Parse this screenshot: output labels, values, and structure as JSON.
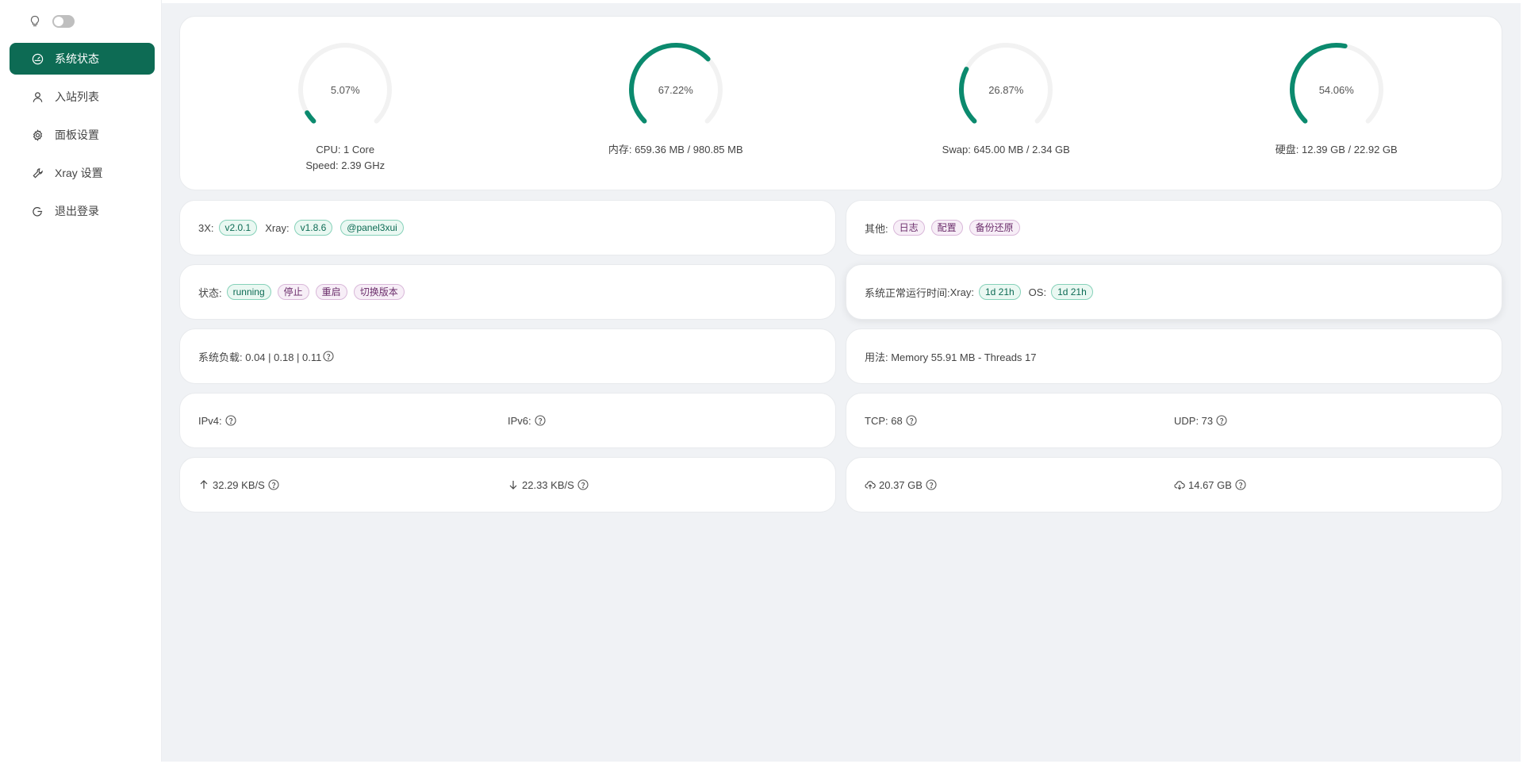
{
  "theme": {
    "toggle_on": false
  },
  "sidebar": {
    "items": [
      {
        "label": "系统状态",
        "icon": "dashboard-icon",
        "active": true
      },
      {
        "label": "入站列表",
        "icon": "user-icon"
      },
      {
        "label": "面板设置",
        "icon": "gear-icon"
      },
      {
        "label": "Xray 设置",
        "icon": "tool-icon"
      },
      {
        "label": "退出登录",
        "icon": "logout-icon"
      }
    ]
  },
  "gauges": [
    {
      "percent_text": "5.07%",
      "percent": 5.07,
      "line1": "CPU: 1 Core",
      "line2": "Speed: 2.39 GHz"
    },
    {
      "percent_text": "67.22%",
      "percent": 67.22,
      "line1": "内存: 659.36 MB / 980.85 MB",
      "line2": ""
    },
    {
      "percent_text": "26.87%",
      "percent": 26.87,
      "line1": "Swap: 645.00 MB / 2.34 GB",
      "line2": ""
    },
    {
      "percent_text": "54.06%",
      "percent": 54.06,
      "line1": "硬盘: 12.39 GB / 22.92 GB",
      "line2": ""
    }
  ],
  "colors": {
    "accent": "#0d6b54",
    "gauge_fg": "#0b8a6e",
    "gauge_bg": "#f2f2f2"
  },
  "version": {
    "label_3x": "3X:",
    "v3x": "v2.0.1",
    "label_xray": "Xray:",
    "vxray": "v1.8.6",
    "tg": "@panel3xui"
  },
  "other": {
    "label": "其他:",
    "log": "日志",
    "config": "配置",
    "backup": "备份还原"
  },
  "status": {
    "label": "状态:",
    "running": "running",
    "stop": "停止",
    "restart": "重启",
    "switch": "切换版本"
  },
  "uptime": {
    "label": "系统正常运行时间:",
    "xray_label": "Xray:",
    "xray": "1d 21h",
    "os_label": "OS:",
    "os": "1d 21h"
  },
  "load": {
    "text": "系统负载: 0.04 | 0.18 | 0.11"
  },
  "usage": {
    "text": "用法: Memory 55.91 MB - Threads 17"
  },
  "ip": {
    "ipv4": "IPv4:",
    "ipv6": "IPv6:"
  },
  "conn": {
    "tcp": "TCP: 68",
    "udp": "UDP: 73"
  },
  "speed": {
    "up": "32.29 KB/S",
    "down": "22.33 KB/S"
  },
  "traffic": {
    "sent": "20.37 GB",
    "recv": "14.67 GB"
  }
}
